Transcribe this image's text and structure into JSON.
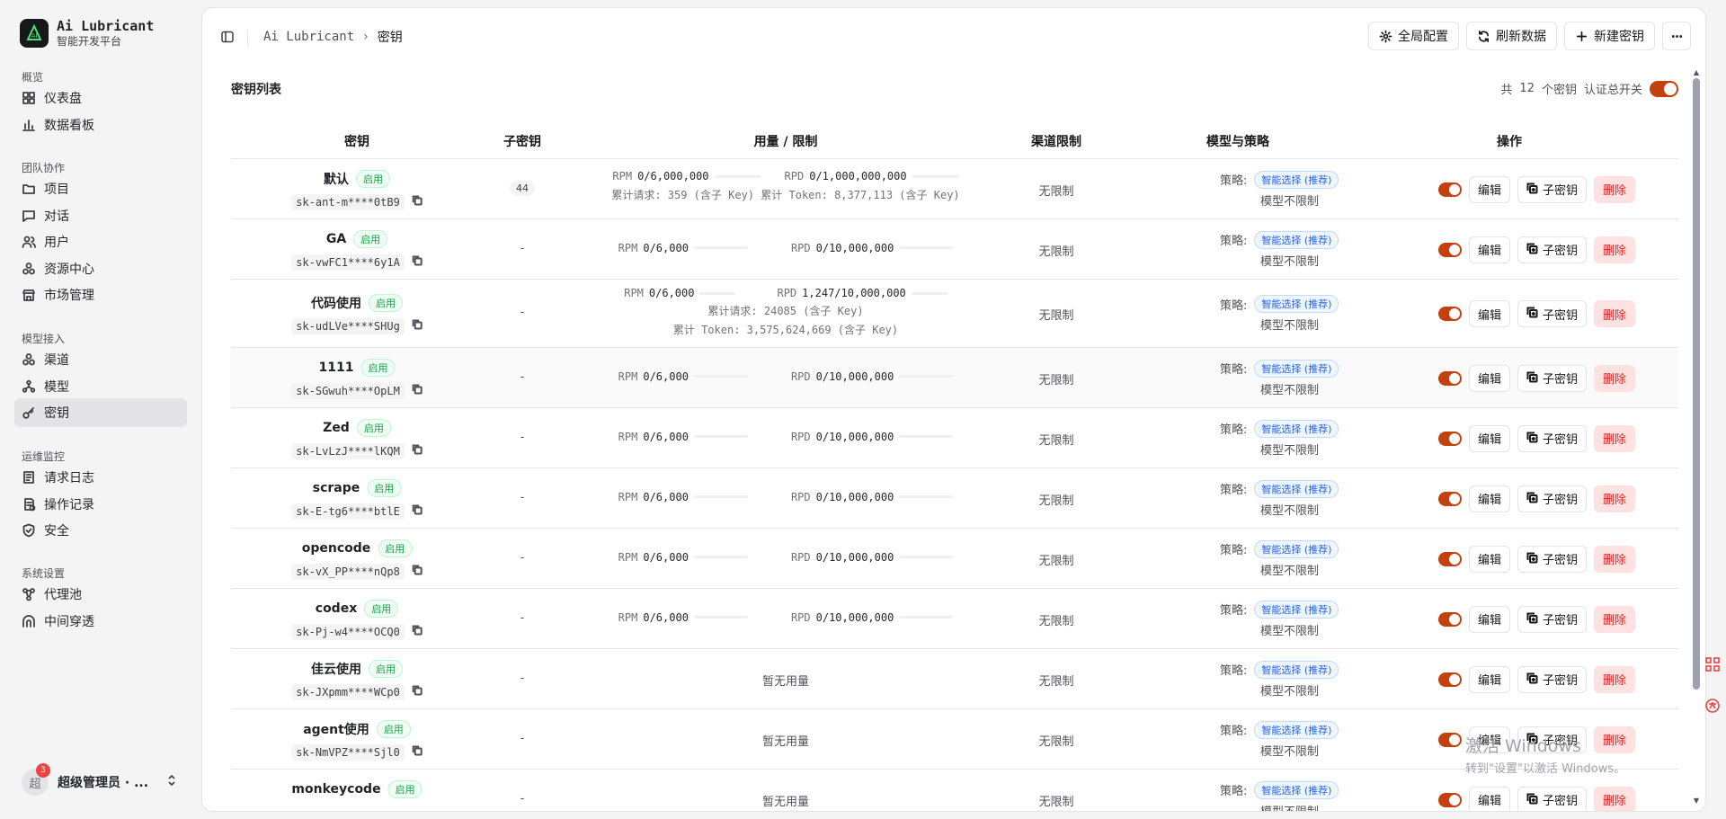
{
  "brand": {
    "name": "Ai Lubricant",
    "subtitle": "智能开发平台"
  },
  "sidebar": {
    "sections": [
      {
        "title": "概览",
        "items": [
          {
            "label": "仪表盘",
            "icon": "dashboard-icon"
          },
          {
            "label": "数据看板",
            "icon": "bar-chart-icon"
          }
        ]
      },
      {
        "title": "团队协作",
        "items": [
          {
            "label": "项目",
            "icon": "folder-icon"
          },
          {
            "label": "对话",
            "icon": "chat-icon"
          },
          {
            "label": "用户",
            "icon": "users-icon"
          },
          {
            "label": "资源中心",
            "icon": "boxes-icon"
          },
          {
            "label": "市场管理",
            "icon": "store-icon"
          }
        ]
      },
      {
        "title": "模型接入",
        "items": [
          {
            "label": "渠道",
            "icon": "boxes-icon"
          },
          {
            "label": "模型",
            "icon": "network-icon"
          },
          {
            "label": "密钥",
            "icon": "key-icon"
          }
        ]
      },
      {
        "title": "运维监控",
        "items": [
          {
            "label": "请求日志",
            "icon": "log-icon"
          },
          {
            "label": "操作记录",
            "icon": "record-icon"
          },
          {
            "label": "安全",
            "icon": "shield-icon"
          }
        ]
      },
      {
        "title": "系统设置",
        "items": [
          {
            "label": "代理池",
            "icon": "proxy-icon"
          },
          {
            "label": "中间穿透",
            "icon": "tunnel-icon"
          }
        ]
      }
    ],
    "active": "密钥",
    "user": {
      "avatar_text": "超",
      "badge": "3",
      "name": "超级管理员 · ..."
    }
  },
  "breadcrumb": {
    "root": "Ai Lubricant",
    "current": "密钥"
  },
  "toolbar": {
    "global_config": "全局配置",
    "refresh": "刷新数据",
    "new_key": "新建密钥"
  },
  "list": {
    "title": "密钥列表",
    "count_prefix": "共",
    "count": "12",
    "count_suffix": "个密钥",
    "auth_switch": "认证总开关",
    "auth_on": true
  },
  "columns": {
    "key": "密钥",
    "sub_key": "子密钥",
    "usage": "用量 / 限制",
    "channel": "渠道限制",
    "model": "模型与策略",
    "ops": "操作"
  },
  "labels": {
    "enabled": "启用",
    "rpm": "RPM",
    "rpd": "RPD",
    "no_usage": "暂无用量",
    "unlimited": "无限制",
    "strategy": "策略:",
    "smart": "智能选择 (推荐)",
    "model_unlimited": "模型不限制",
    "edit": "编辑",
    "sub_key_btn": "子密钥",
    "delete": "删除"
  },
  "rows": [
    {
      "name": "默认",
      "mask": "sk-ant-m****0tB9",
      "sub": "44",
      "rpm": "0/6,000,000",
      "rpd": "0/1,000,000,000",
      "note1": "累计请求: 359 (含子 Key)",
      "note2": "累计 Token: 8,377,113 (含子 Key)",
      "mode": "inline"
    },
    {
      "name": "GA",
      "mask": "sk-vwFC1****6y1A",
      "sub": "-",
      "rpm": "0/6,000",
      "rpd": "0/10,000,000",
      "mode": "simple"
    },
    {
      "name": "代码使用",
      "mask": "sk-udLVe****SHUg",
      "sub": "-",
      "rpm": "0/6,000",
      "rpd": "1,247/10,000,000",
      "note1": "累计请求: 24085 (含子 Key)",
      "note2": "累计 Token: 3,575,624,669 (含子 Key)",
      "mode": "stacked"
    },
    {
      "name": "1111",
      "mask": "sk-SGwuh****OpLM",
      "sub": "-",
      "rpm": "0/6,000",
      "rpd": "0/10,000,000",
      "mode": "simple"
    },
    {
      "name": "Zed",
      "mask": "sk-LvLzJ****lKQM",
      "sub": "-",
      "rpm": "0/6,000",
      "rpd": "0/10,000,000",
      "mode": "simple"
    },
    {
      "name": "scrape",
      "mask": "sk-E-tg6****btlE",
      "sub": "-",
      "rpm": "0/6,000",
      "rpd": "0/10,000,000",
      "mode": "simple"
    },
    {
      "name": "opencode",
      "mask": "sk-vX_PP****nQp8",
      "sub": "-",
      "rpm": "0/6,000",
      "rpd": "0/10,000,000",
      "mode": "simple"
    },
    {
      "name": "codex",
      "mask": "sk-Pj-w4****OCQ0",
      "sub": "-",
      "rpm": "0/6,000",
      "rpd": "0/10,000,000",
      "mode": "simple"
    },
    {
      "name": "佳云使用",
      "mask": "sk-JXpmm****WCp0",
      "sub": "-",
      "mode": "none"
    },
    {
      "name": "agent使用",
      "mask": "sk-NmVPZ****Sjl0",
      "sub": "-",
      "mode": "none"
    },
    {
      "name": "monkeycode",
      "mask": "",
      "sub": "-",
      "mode": "none"
    }
  ],
  "watermark": {
    "line1": "激活 Windows",
    "line2": "转到\"设置\"以激活 Windows。"
  }
}
